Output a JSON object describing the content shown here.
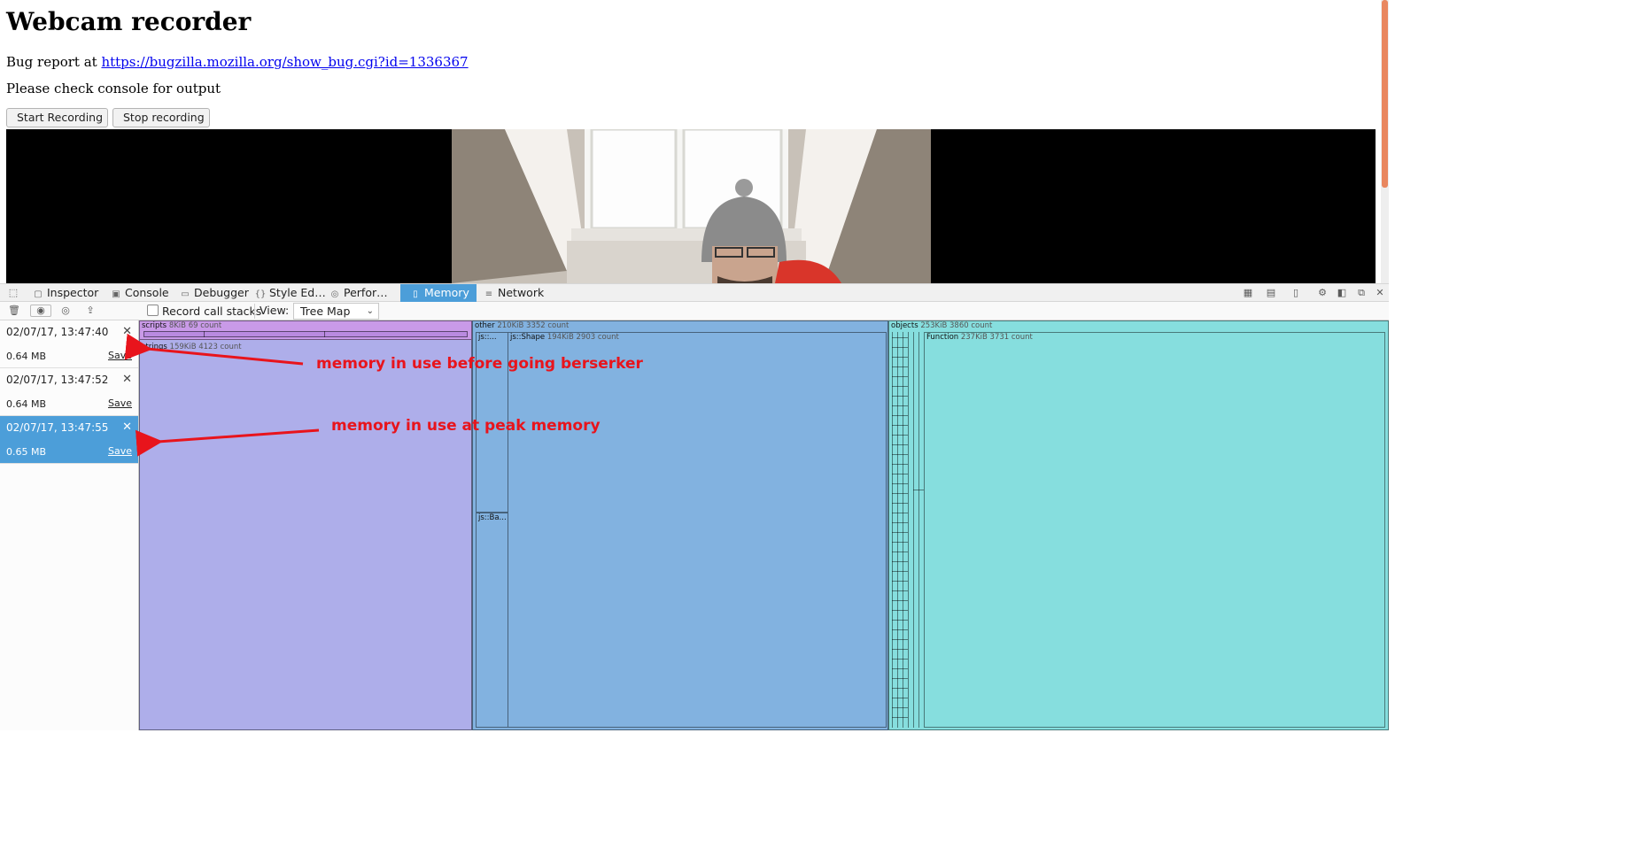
{
  "page": {
    "title": "Webcam recorder",
    "bug_prefix": "Bug report at ",
    "bug_url": "https://bugzilla.mozilla.org/show_bug.cgi?id=1336367",
    "console_note": "Please check console for output",
    "start_button": "Start Recording",
    "stop_button": "Stop recording"
  },
  "devtools": {
    "tabs": [
      {
        "label": "Inspector",
        "icon": "inspector-icon"
      },
      {
        "label": "Console",
        "icon": "console-icon"
      },
      {
        "label": "Debugger",
        "icon": "debugger-icon"
      },
      {
        "label": "Style Ed…",
        "icon": "style-editor-icon"
      },
      {
        "label": "Perfor…",
        "icon": "performance-icon"
      },
      {
        "label": "Memory",
        "icon": "memory-icon",
        "active": true
      },
      {
        "label": "Network",
        "icon": "network-icon"
      }
    ],
    "memory_toolbar": {
      "record_call_stacks": "Record call stacks",
      "record_checked": false,
      "view_label": "View:",
      "view_value": "Tree Map"
    },
    "snapshots": [
      {
        "date": "02/07/17, 13:47:40",
        "size": "0.64 MB",
        "save": "Save",
        "selected": false
      },
      {
        "date": "02/07/17, 13:47:52",
        "size": "0.64 MB",
        "save": "Save",
        "selected": false
      },
      {
        "date": "02/07/17, 13:47:55",
        "size": "0.65 MB",
        "save": "Save",
        "selected": true
      }
    ],
    "treemap": {
      "scripts": {
        "name": "scripts",
        "meta": "8KiB 69 count"
      },
      "strings": {
        "name": "strings",
        "meta": "159KiB 4123 count"
      },
      "other": {
        "name": "other",
        "meta": "210KiB 3352 count"
      },
      "js_short": {
        "name": "js::..."
      },
      "js_shape": {
        "name": "js::Shape",
        "meta": "194KiB 2903 count"
      },
      "js_ba": {
        "name": "js::Ba..."
      },
      "objects": {
        "name": "objects",
        "meta": "253KiB 3860 count"
      },
      "function": {
        "name": "Function",
        "meta": "237KiB 3731 count"
      }
    },
    "colors": {
      "accent": "#4c9ed9",
      "scripts": "#c99ae8",
      "strings": "#aeaeea",
      "other": "#82b2e0",
      "objects": "#86dede"
    }
  },
  "annotations": {
    "before": "memory in use before going berserker",
    "peak": "memory in use at peak memory",
    "color": "#e8141c"
  }
}
